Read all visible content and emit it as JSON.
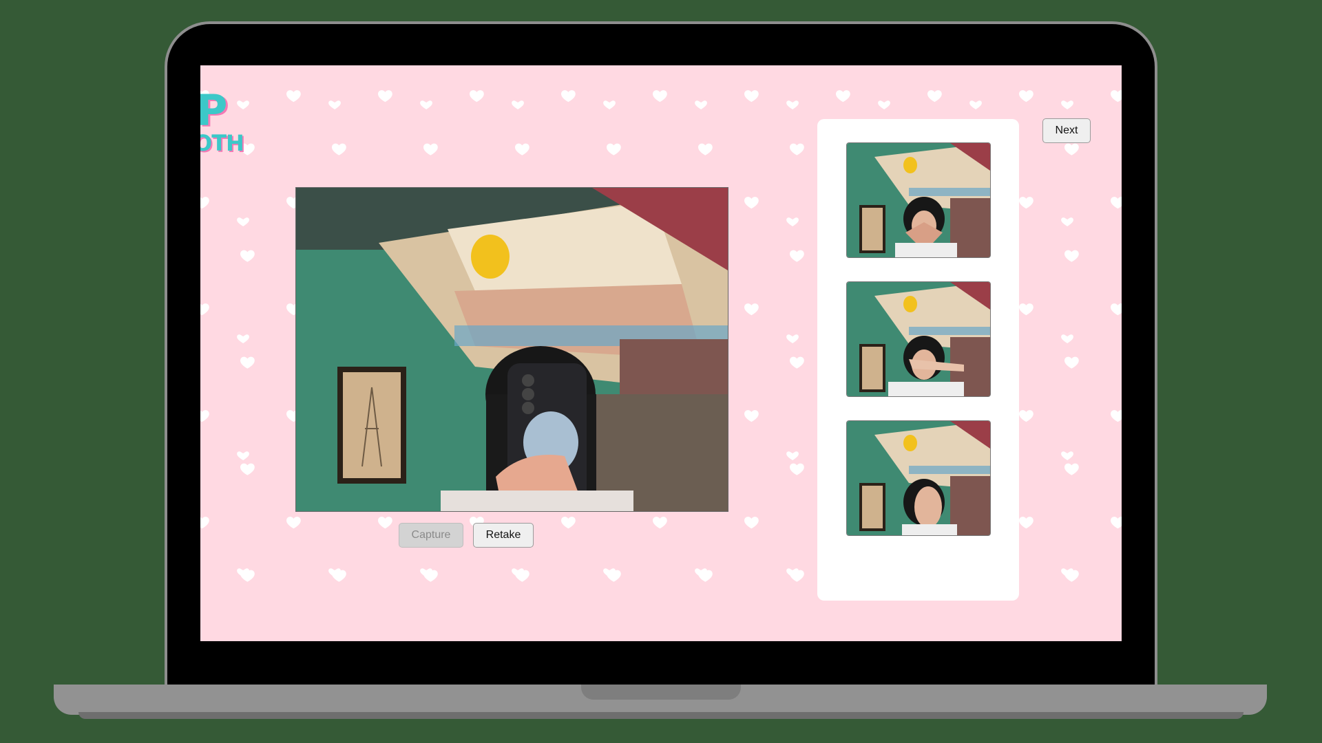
{
  "app": {
    "logo_line1": "P",
    "logo_line2": "OTH"
  },
  "camera": {
    "capture_label": "Capture",
    "retake_label": "Retake",
    "capture_enabled": false
  },
  "header": {
    "next_label": "Next"
  },
  "strip": {
    "photos": [
      {
        "pose": "heart-hands"
      },
      {
        "pose": "hand-over-face"
      },
      {
        "pose": "palm-over-face"
      }
    ]
  },
  "colors": {
    "background": "#355a36",
    "page_pink": "#ffd9e2",
    "logo_teal": "#3cc8c8",
    "logo_pink": "#f47ab5"
  }
}
